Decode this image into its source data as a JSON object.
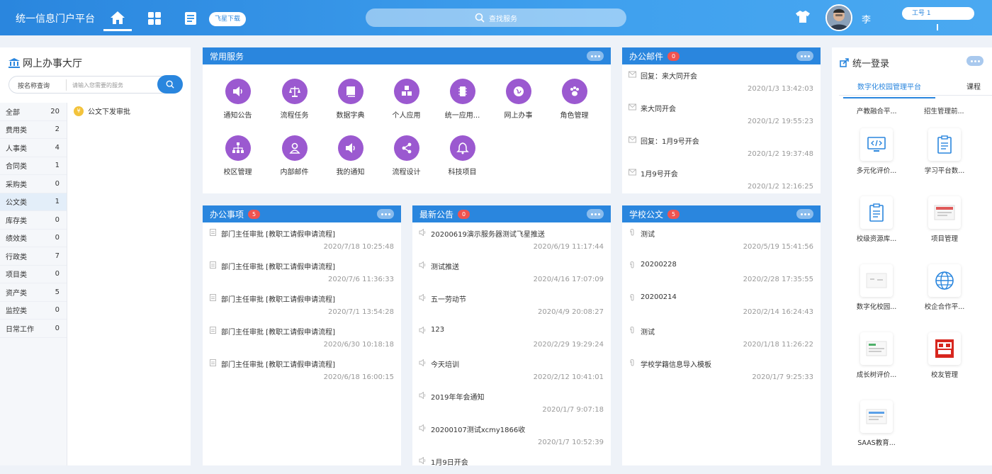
{
  "header": {
    "title": "统一信息门户平台",
    "download_label": "飞星下载",
    "search_placeholder": "查找服务",
    "user_name": "李",
    "user_id": "工号 1"
  },
  "left": {
    "title": "网上办事大厅",
    "search_scope": "按名称查询",
    "search_placeholder": "请输入您需要的服务",
    "categories": [
      {
        "name": "全部",
        "count": "20"
      },
      {
        "name": "费用类",
        "count": "2"
      },
      {
        "name": "人事类",
        "count": "4"
      },
      {
        "name": "合同类",
        "count": "1"
      },
      {
        "name": "采购类",
        "count": "0"
      },
      {
        "name": "公文类",
        "count": "1"
      },
      {
        "name": "库存类",
        "count": "0"
      },
      {
        "name": "绩效类",
        "count": "0"
      },
      {
        "name": "行政类",
        "count": "7"
      },
      {
        "name": "项目类",
        "count": "0"
      },
      {
        "name": "资产类",
        "count": "5"
      },
      {
        "name": "监控类",
        "count": "0"
      },
      {
        "name": "日常工作",
        "count": "0"
      }
    ],
    "selected_item": "公文下发审批"
  },
  "services": {
    "title": "常用服务",
    "items": [
      "通知公告",
      "流程任务",
      "数据字典",
      "个人应用",
      "统一应用...",
      "网上办事",
      "角色管理",
      "校区管理",
      "内部邮件",
      "我的通知",
      "流程设计",
      "科技项目"
    ]
  },
  "mail": {
    "title": "办公邮件",
    "badge": "0",
    "items": [
      {
        "title": "回复：来大同开会",
        "time": "2020/1/3 13:42:03"
      },
      {
        "title": "来大同开会",
        "time": "2020/1/2 19:55:23"
      },
      {
        "title": "回复：1月9号开会",
        "time": "2020/1/2 19:37:48"
      },
      {
        "title": "1月9号开会",
        "time": "2020/1/2 12:16:25"
      }
    ]
  },
  "tasks": {
    "title": "办公事项",
    "badge": "5",
    "items": [
      {
        "title": "部门主任审批 [教职工请假申请流程]",
        "time": "2020/7/18 10:25:48"
      },
      {
        "title": "部门主任审批 [教职工请假申请流程]",
        "time": "2020/7/6 11:36:33"
      },
      {
        "title": "部门主任审批 [教职工请假申请流程]",
        "time": "2020/7/1 13:54:28"
      },
      {
        "title": "部门主任审批 [教职工请假申请流程]",
        "time": "2020/6/30 10:18:18"
      },
      {
        "title": "部门主任审批 [教职工请假申请流程]",
        "time": "2020/6/18 16:00:15"
      }
    ]
  },
  "notices": {
    "title": "最新公告",
    "badge": "0",
    "items": [
      {
        "title": "20200619演示服务器测试飞星推送",
        "time": "2020/6/19 11:17:44"
      },
      {
        "title": "测试推送",
        "time": "2020/4/16 17:07:09"
      },
      {
        "title": "五一劳动节",
        "time": "2020/4/9 20:08:27"
      },
      {
        "title": "123",
        "time": "2020/2/29 19:29:24"
      },
      {
        "title": "今天培训",
        "time": "2020/2/12 10:41:01"
      },
      {
        "title": "2019年年会通知",
        "time": "2020/1/7 9:07:18"
      },
      {
        "title": "20200107测试xcmy1866收",
        "time": "2020/1/7 10:52:39"
      },
      {
        "title": "1月9日开会",
        "time": ""
      }
    ]
  },
  "docs": {
    "title": "学校公文",
    "badge": "5",
    "items": [
      {
        "title": "测试",
        "time": "2020/5/19 15:41:56"
      },
      {
        "title": "20200228",
        "time": "2020/2/28 17:35:55"
      },
      {
        "title": "20200214",
        "time": "2020/2/14 16:24:43"
      },
      {
        "title": "测试",
        "time": "2020/1/18 11:26:22"
      },
      {
        "title": "学校学籍信息导入模板",
        "time": "2020/1/7 9:25:33"
      }
    ]
  },
  "sso": {
    "title": "统一登录",
    "tabs": [
      "数字化校园管理平台",
      "课程"
    ],
    "top_links": [
      "产教融合平...",
      "招生管理前..."
    ],
    "apps": [
      "多元化评价...",
      "学习平台数...",
      "校级资源库...",
      "项目管理",
      "数字化校园...",
      "校企合作平...",
      "成长树评价...",
      "校友管理",
      "SAAS教育..."
    ]
  },
  "colors": {
    "primary": "#2a86de",
    "service_icon": "#9b59d0",
    "badge": "#ef5350"
  }
}
